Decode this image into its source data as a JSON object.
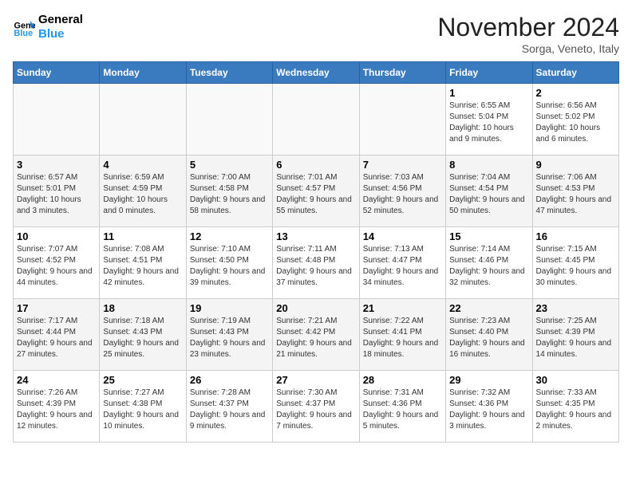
{
  "logo": {
    "line1": "General",
    "line2": "Blue"
  },
  "title": "November 2024",
  "location": "Sorga, Veneto, Italy",
  "days_of_week": [
    "Sunday",
    "Monday",
    "Tuesday",
    "Wednesday",
    "Thursday",
    "Friday",
    "Saturday"
  ],
  "weeks": [
    [
      {
        "day": "",
        "info": ""
      },
      {
        "day": "",
        "info": ""
      },
      {
        "day": "",
        "info": ""
      },
      {
        "day": "",
        "info": ""
      },
      {
        "day": "",
        "info": ""
      },
      {
        "day": "1",
        "info": "Sunrise: 6:55 AM\nSunset: 5:04 PM\nDaylight: 10 hours\nand 9 minutes."
      },
      {
        "day": "2",
        "info": "Sunrise: 6:56 AM\nSunset: 5:02 PM\nDaylight: 10 hours\nand 6 minutes."
      }
    ],
    [
      {
        "day": "3",
        "info": "Sunrise: 6:57 AM\nSunset: 5:01 PM\nDaylight: 10 hours\nand 3 minutes."
      },
      {
        "day": "4",
        "info": "Sunrise: 6:59 AM\nSunset: 4:59 PM\nDaylight: 10 hours\nand 0 minutes."
      },
      {
        "day": "5",
        "info": "Sunrise: 7:00 AM\nSunset: 4:58 PM\nDaylight: 9 hours\nand 58 minutes."
      },
      {
        "day": "6",
        "info": "Sunrise: 7:01 AM\nSunset: 4:57 PM\nDaylight: 9 hours\nand 55 minutes."
      },
      {
        "day": "7",
        "info": "Sunrise: 7:03 AM\nSunset: 4:56 PM\nDaylight: 9 hours\nand 52 minutes."
      },
      {
        "day": "8",
        "info": "Sunrise: 7:04 AM\nSunset: 4:54 PM\nDaylight: 9 hours\nand 50 minutes."
      },
      {
        "day": "9",
        "info": "Sunrise: 7:06 AM\nSunset: 4:53 PM\nDaylight: 9 hours\nand 47 minutes."
      }
    ],
    [
      {
        "day": "10",
        "info": "Sunrise: 7:07 AM\nSunset: 4:52 PM\nDaylight: 9 hours\nand 44 minutes."
      },
      {
        "day": "11",
        "info": "Sunrise: 7:08 AM\nSunset: 4:51 PM\nDaylight: 9 hours\nand 42 minutes."
      },
      {
        "day": "12",
        "info": "Sunrise: 7:10 AM\nSunset: 4:50 PM\nDaylight: 9 hours\nand 39 minutes."
      },
      {
        "day": "13",
        "info": "Sunrise: 7:11 AM\nSunset: 4:48 PM\nDaylight: 9 hours\nand 37 minutes."
      },
      {
        "day": "14",
        "info": "Sunrise: 7:13 AM\nSunset: 4:47 PM\nDaylight: 9 hours\nand 34 minutes."
      },
      {
        "day": "15",
        "info": "Sunrise: 7:14 AM\nSunset: 4:46 PM\nDaylight: 9 hours\nand 32 minutes."
      },
      {
        "day": "16",
        "info": "Sunrise: 7:15 AM\nSunset: 4:45 PM\nDaylight: 9 hours\nand 30 minutes."
      }
    ],
    [
      {
        "day": "17",
        "info": "Sunrise: 7:17 AM\nSunset: 4:44 PM\nDaylight: 9 hours\nand 27 minutes."
      },
      {
        "day": "18",
        "info": "Sunrise: 7:18 AM\nSunset: 4:43 PM\nDaylight: 9 hours\nand 25 minutes."
      },
      {
        "day": "19",
        "info": "Sunrise: 7:19 AM\nSunset: 4:43 PM\nDaylight: 9 hours\nand 23 minutes."
      },
      {
        "day": "20",
        "info": "Sunrise: 7:21 AM\nSunset: 4:42 PM\nDaylight: 9 hours\nand 21 minutes."
      },
      {
        "day": "21",
        "info": "Sunrise: 7:22 AM\nSunset: 4:41 PM\nDaylight: 9 hours\nand 18 minutes."
      },
      {
        "day": "22",
        "info": "Sunrise: 7:23 AM\nSunset: 4:40 PM\nDaylight: 9 hours\nand 16 minutes."
      },
      {
        "day": "23",
        "info": "Sunrise: 7:25 AM\nSunset: 4:39 PM\nDaylight: 9 hours\nand 14 minutes."
      }
    ],
    [
      {
        "day": "24",
        "info": "Sunrise: 7:26 AM\nSunset: 4:39 PM\nDaylight: 9 hours\nand 12 minutes."
      },
      {
        "day": "25",
        "info": "Sunrise: 7:27 AM\nSunset: 4:38 PM\nDaylight: 9 hours\nand 10 minutes."
      },
      {
        "day": "26",
        "info": "Sunrise: 7:28 AM\nSunset: 4:37 PM\nDaylight: 9 hours\nand 9 minutes."
      },
      {
        "day": "27",
        "info": "Sunrise: 7:30 AM\nSunset: 4:37 PM\nDaylight: 9 hours\nand 7 minutes."
      },
      {
        "day": "28",
        "info": "Sunrise: 7:31 AM\nSunset: 4:36 PM\nDaylight: 9 hours\nand 5 minutes."
      },
      {
        "day": "29",
        "info": "Sunrise: 7:32 AM\nSunset: 4:36 PM\nDaylight: 9 hours\nand 3 minutes."
      },
      {
        "day": "30",
        "info": "Sunrise: 7:33 AM\nSunset: 4:35 PM\nDaylight: 9 hours\nand 2 minutes."
      }
    ]
  ]
}
